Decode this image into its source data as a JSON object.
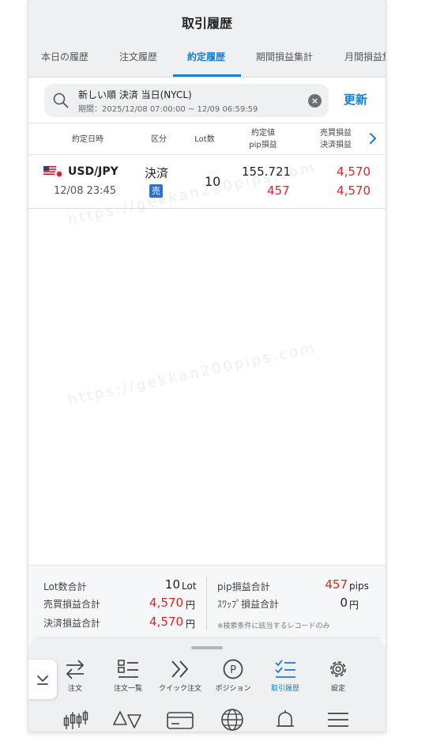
{
  "header": {
    "title": "取引履歴",
    "tabs": [
      {
        "label": "本日の履歴"
      },
      {
        "label": "注文履歴"
      },
      {
        "label": "約定履歴"
      },
      {
        "label": "期間損益集計"
      },
      {
        "label": "月間損益集"
      }
    ],
    "active_tab": "約定履歴"
  },
  "search": {
    "line1": "新しい順 決済 当日(NYCL)",
    "line2": "期間：2025/12/08 07:00:00 ~ 12/09 06:59:59",
    "clear_icon": "×",
    "refresh_label": "更新"
  },
  "columns": {
    "date": "約定日時",
    "type": "区分",
    "lot": "Lot数",
    "price_line1": "約定値",
    "price_line2": "pip損益",
    "pl_line1": "売買損益",
    "pl_line2": "決済損益"
  },
  "rows": [
    {
      "pair": "USD/JPY",
      "datetime": "12/08 23:45",
      "type": "決済",
      "side": "売",
      "lot": "10",
      "price": "155.721",
      "pips": "457",
      "trade_pl": "4,570",
      "settle_pl": "4,570"
    }
  ],
  "watermark": "https://gekkan200pips.com",
  "summary": {
    "lot_label": "Lot数合計",
    "lot_value": "10",
    "lot_unit": "Lot",
    "trade_label": "売買損益合計",
    "trade_value": "4,570",
    "trade_unit": "円",
    "settle_label": "決済損益合計",
    "settle_value": "4,570",
    "settle_unit": "円",
    "pip_label": "pip損益合計",
    "pip_value": "457",
    "pip_unit": "pips",
    "swap_label": "ｽﾜｯﾌﾟ損益合計",
    "swap_value": "0",
    "swap_unit": "円",
    "note": "※検索条件に該当するレコードのみ"
  },
  "bottom_nav": {
    "items": [
      {
        "label": "注文",
        "icon": "swap-arrows-icon"
      },
      {
        "label": "注文一覧",
        "icon": "list-icon"
      },
      {
        "label": "クイック注文",
        "icon": "double-chevron-icon"
      },
      {
        "label": "ポジション",
        "icon": "p-circle-icon"
      },
      {
        "label": "取引履歴",
        "icon": "checklist-icon"
      },
      {
        "label": "設定",
        "icon": "gear-icon"
      }
    ],
    "active": "取引履歴",
    "tools": [
      "candlestick-icon",
      "triangles-icon",
      "card-icon",
      "globe-icon",
      "bell-icon",
      "menu-icon"
    ]
  },
  "colors": {
    "accent": "#1a7fd4",
    "loss_profit_red": "#d6262b",
    "sell_badge": "#2c6fd1"
  }
}
